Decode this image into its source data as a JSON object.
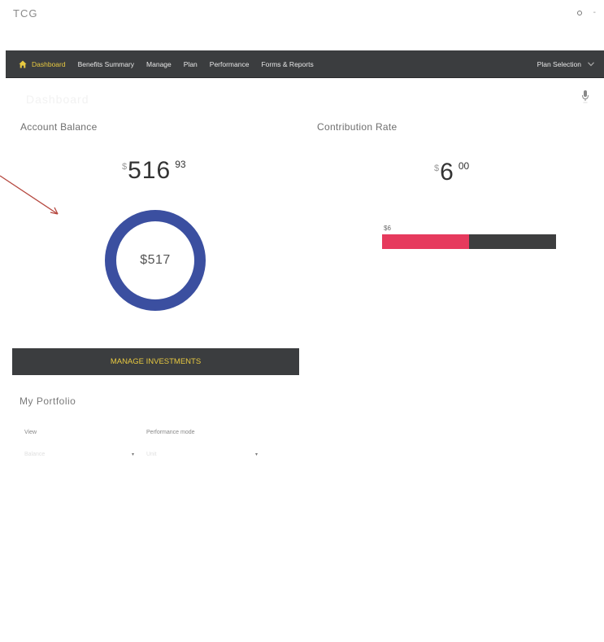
{
  "app": {
    "brand": "TCG"
  },
  "window": {
    "close_glyph": "-"
  },
  "nav": {
    "items": [
      {
        "label": "Dashboard",
        "active": true
      },
      {
        "label": "Benefits Summary"
      },
      {
        "label": "Manage"
      },
      {
        "label": "Plan"
      },
      {
        "label": "Performance"
      },
      {
        "label": "Forms & Reports"
      }
    ],
    "plan_selection": "Plan Selection",
    "accent": "#e8c940",
    "background": "#3b3d3f"
  },
  "dashboard": {
    "faded_title": "Dashboard"
  },
  "account_balance": {
    "label": "Account Balance",
    "currency": "$",
    "amount_main": "516",
    "amount_cents": "93",
    "donut_label": "$517",
    "donut_color": "#3b4fa0"
  },
  "contribution_rate": {
    "label": "Contribution Rate",
    "currency": "$",
    "amount_main": "6",
    "amount_cents": "00",
    "bar_label": "$6",
    "fill_fraction": 0.5,
    "fill_color": "#e63a5d",
    "track_color": "#3d3e3f"
  },
  "manage_investments": {
    "label": "MANAGE INVESTMENTS"
  },
  "portfolio": {
    "title": "My Portfolio",
    "view_label": "View",
    "view_value": "Balance",
    "performance_label": "Performance mode",
    "performance_value": "Unit"
  },
  "icons": {
    "home": "home-icon",
    "mic": "microphone-icon",
    "settings": "settings-icon",
    "chevron": "chevron-down-icon"
  }
}
